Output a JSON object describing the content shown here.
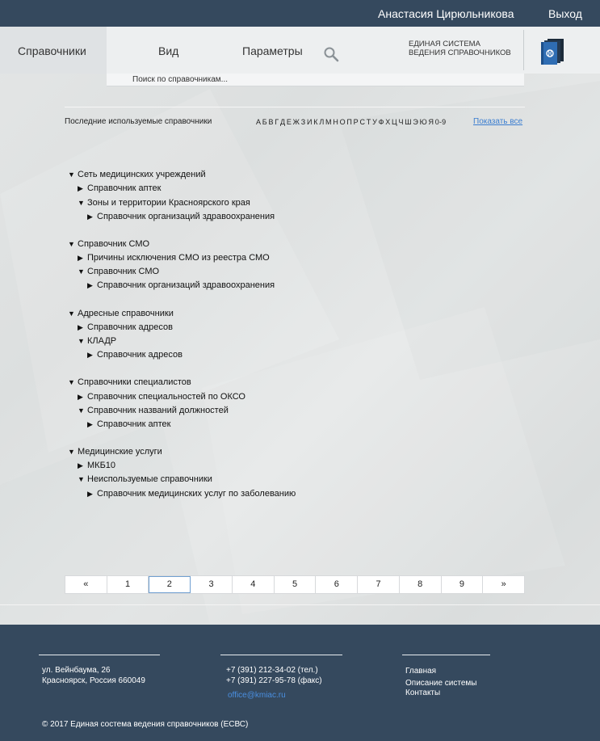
{
  "topbar": {
    "user_name": "Анастасия Цирюльникова",
    "logout_label": "Выход"
  },
  "nav": {
    "active_tab": "Справочники",
    "tabs": [
      "Вид",
      "Параметры"
    ],
    "search_icon": "search-icon",
    "system_name": "ЕДИНАЯ СИСТЕМА ВЕДЕНИЯ СПРАВОЧНИКОВ",
    "logo_icon": "book-logo-icon"
  },
  "search": {
    "placeholder": "Поиск по справочникам..."
  },
  "recent": {
    "label": "Последние используемые справочники",
    "show_all": "Показать все"
  },
  "alphabet": [
    "А",
    "Б",
    "В",
    "Г",
    "Д",
    "Е",
    "Ж",
    "З",
    "И",
    "К",
    "Л",
    "М",
    "Н",
    "О",
    "П",
    "Р",
    "С",
    "Т",
    "У",
    "Ф",
    "Х",
    "Ц",
    "Ч",
    "Ш",
    "Э",
    "Ю",
    "Я",
    "0-9"
  ],
  "tree": [
    {
      "level": 0,
      "expanded": true,
      "label": "Сеть медицинских учреждений"
    },
    {
      "level": 1,
      "expanded": false,
      "label": "Справочник аптек"
    },
    {
      "level": 1,
      "expanded": true,
      "label": "Зоны и территории Красноярского края"
    },
    {
      "level": 2,
      "expanded": false,
      "label": "Справочник организаций здравоохранения"
    },
    {
      "level": 0,
      "expanded": true,
      "label": "Справочник СМО"
    },
    {
      "level": 1,
      "expanded": false,
      "label": "Причины исключения СМО из реестра СМО"
    },
    {
      "level": 1,
      "expanded": true,
      "label": "Справочник СМО"
    },
    {
      "level": 2,
      "expanded": false,
      "label": "Справочник организаций здравоохранения"
    },
    {
      "level": 0,
      "expanded": true,
      "label": "Адресные справочники"
    },
    {
      "level": 1,
      "expanded": false,
      "label": "Справочник адресов"
    },
    {
      "level": 1,
      "expanded": true,
      "label": "КЛАДР"
    },
    {
      "level": 2,
      "expanded": false,
      "label": "Справочник адресов"
    },
    {
      "level": 0,
      "expanded": true,
      "label": "Справочники специалистов"
    },
    {
      "level": 1,
      "expanded": false,
      "label": "Справочник специальностей по ОКСО"
    },
    {
      "level": 1,
      "expanded": true,
      "label": "Справочник названий должностей"
    },
    {
      "level": 2,
      "expanded": false,
      "label": "Справочник аптек"
    },
    {
      "level": 0,
      "expanded": true,
      "label": "Медицинские услуги"
    },
    {
      "level": 1,
      "expanded": false,
      "label": "МКБ10"
    },
    {
      "level": 1,
      "expanded": true,
      "label": "Неиспользуемые справочники"
    },
    {
      "level": 2,
      "expanded": false,
      "label": "Справочник медицинских услуг по заболеванию"
    }
  ],
  "pagination": {
    "prev": "«",
    "next": "»",
    "pages": [
      "1",
      "2",
      "3",
      "4",
      "5",
      "6",
      "7",
      "8",
      "9"
    ],
    "current": "2"
  },
  "footer": {
    "address_line1": "ул. Вейнбаума, 26",
    "address_line2": "Красноярск, Россия 660049",
    "phone": "+7 (391) 212-34-02 (тел.)",
    "fax": "+7 (391) 227-95-78 (факс)",
    "email": "office@kmiac.ru",
    "links": [
      "Главная",
      "Описание системы",
      "Контакты"
    ],
    "copyright": "©  2017 Единая состема ведения справочников (ЕСВС)"
  }
}
